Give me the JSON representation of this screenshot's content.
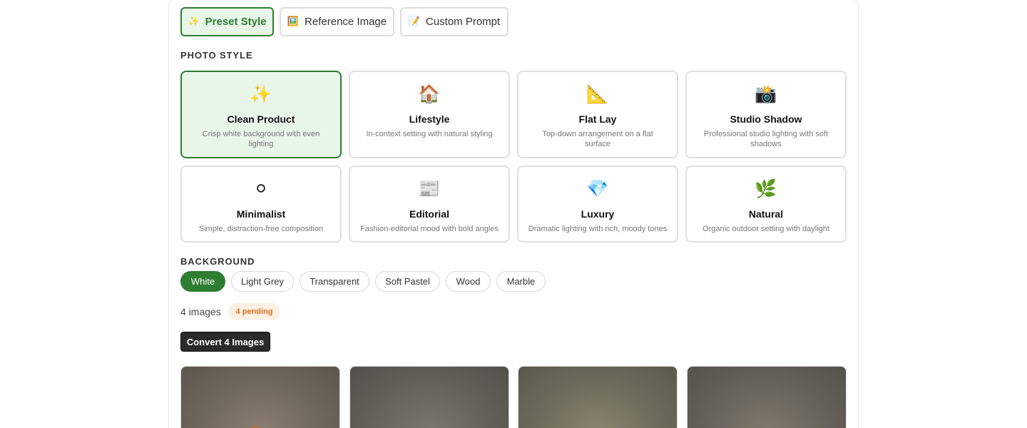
{
  "mode_tabs": [
    {
      "icon": "✨",
      "label": "Preset Style"
    },
    {
      "icon": "🖼️",
      "label": "Reference Image"
    },
    {
      "icon": "📝",
      "label": "Custom Prompt"
    }
  ],
  "active_mode": "Preset Style",
  "photo_style": {
    "heading": "PHOTO STYLE",
    "selected": "Clean Product",
    "cards": [
      {
        "icon": "✨",
        "title": "Clean Product",
        "desc": "Crisp white background with even lighting"
      },
      {
        "icon": "🏠",
        "title": "Lifestyle",
        "desc": "In-context setting with natural styling"
      },
      {
        "icon": "📐",
        "title": "Flat Lay",
        "desc": "Top-down arrangement on a flat surface"
      },
      {
        "icon": "📸",
        "title": "Studio Shadow",
        "desc": "Professional studio lighting with soft shadows"
      },
      {
        "icon": "⚪",
        "title": "Minimalist",
        "desc": "Simple, distraction-free composition"
      },
      {
        "icon": "📰",
        "title": "Editorial",
        "desc": "Fashion-editorial mood with bold angles"
      },
      {
        "icon": "💎",
        "title": "Luxury",
        "desc": "Dramatic lighting with rich, moody tones"
      },
      {
        "icon": "🌿",
        "title": "Natural",
        "desc": "Organic outdoor setting with daylight"
      }
    ]
  },
  "background": {
    "heading": "BACKGROUND",
    "selected": "White",
    "options": [
      "White",
      "Light Grey",
      "Transparent",
      "Soft Pastel",
      "Wood",
      "Marble"
    ]
  },
  "status": {
    "count_text": "4 images",
    "pending_badge": "4 pending"
  },
  "convert_button": "Convert 4 Images",
  "colors": {
    "accent": "#2e7d32",
    "accent_bg": "#e8f5e9",
    "pending_text": "#d9701c",
    "pending_bg": "#fdf0e4"
  }
}
